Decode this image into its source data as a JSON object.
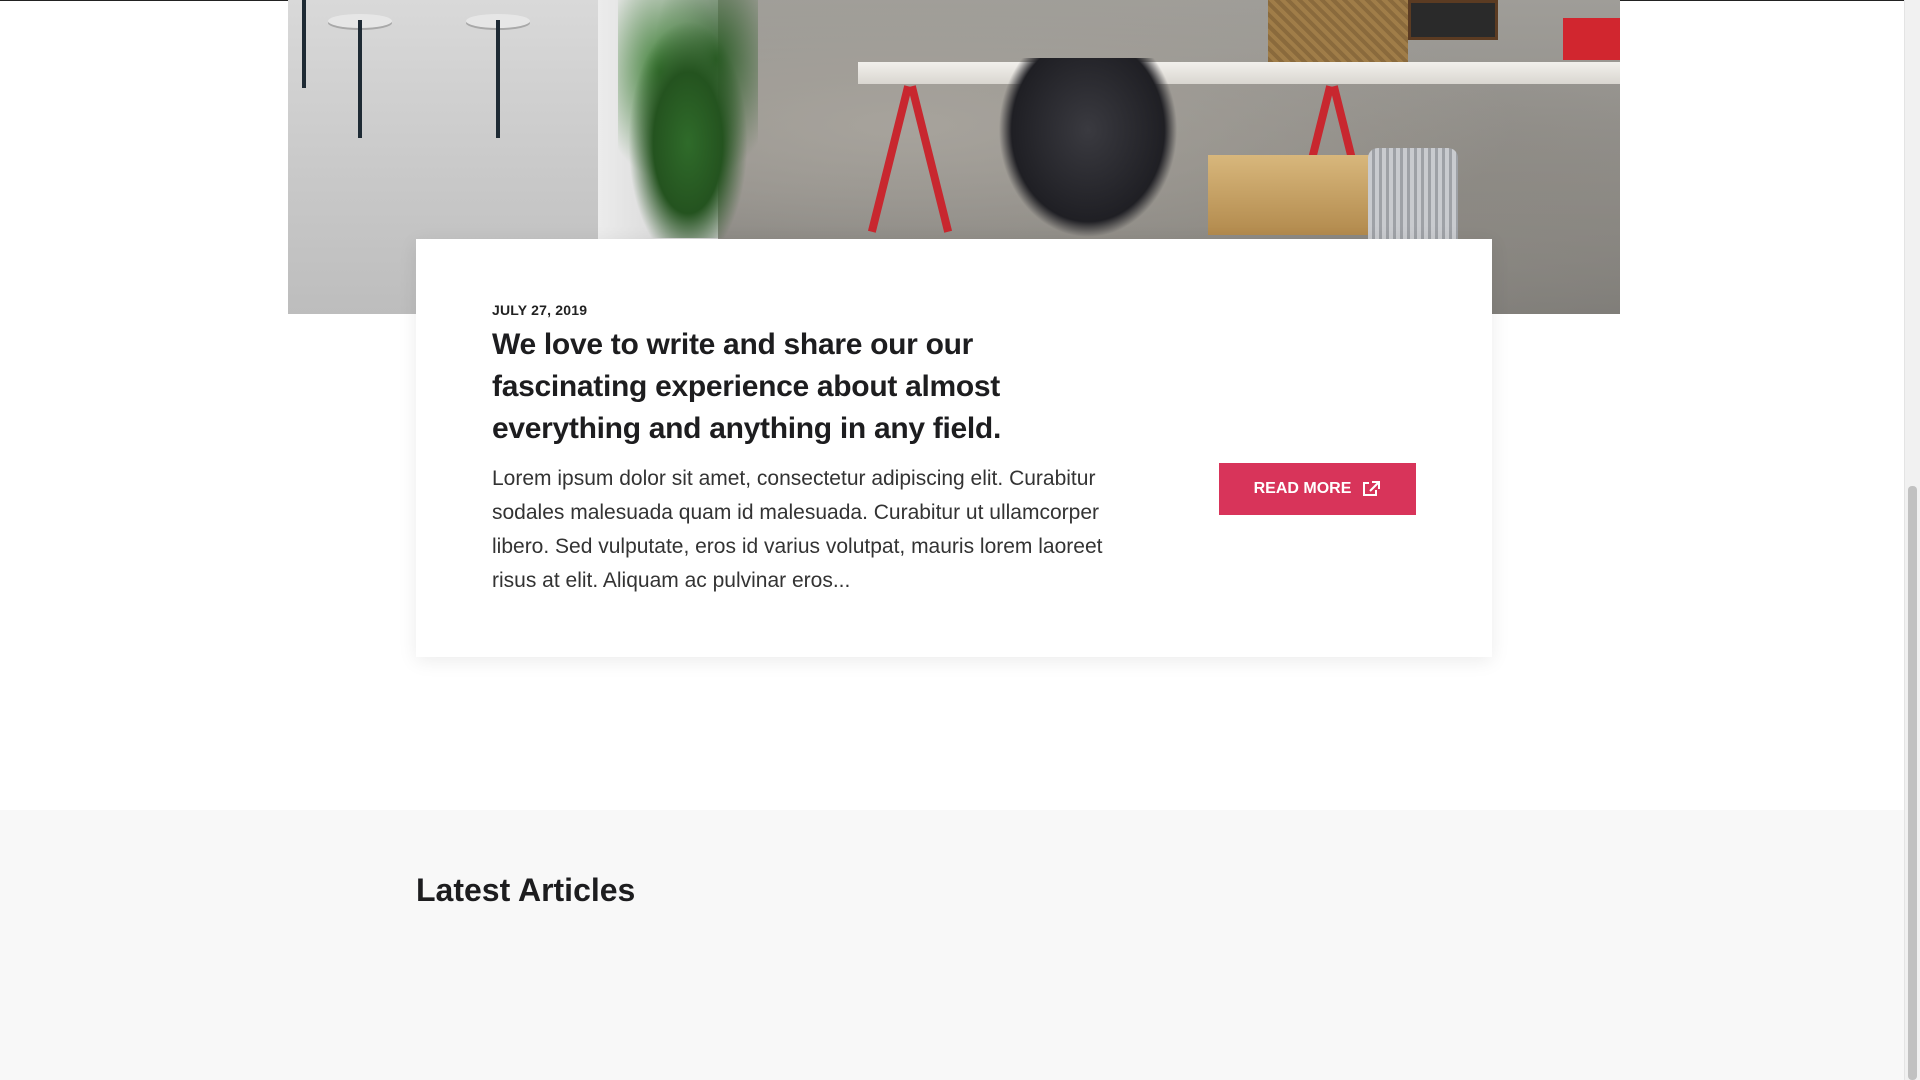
{
  "post": {
    "date": "JULY 27, 2019",
    "title": "We love to write and share our our fascinating experience about almost everything and anything in any field.",
    "excerpt": "Lorem ipsum dolor sit amet, consectetur adipiscing elit. Curabitur sodales malesuada quam id malesuada. Curabitur ut ullamcorper libero. Sed vulputate, eros id varius volutpat, mauris lorem laoreet risus at elit. Aliquam ac pulvinar eros...",
    "read_more_label": "READ MORE",
    "read_more_icon": "external-link-icon",
    "accent_color": "#d8345a"
  },
  "latest": {
    "heading": "Latest Articles",
    "background_color": "#f8f8f8"
  },
  "hero_image": {
    "description_icon": "office-workspace-photo"
  }
}
